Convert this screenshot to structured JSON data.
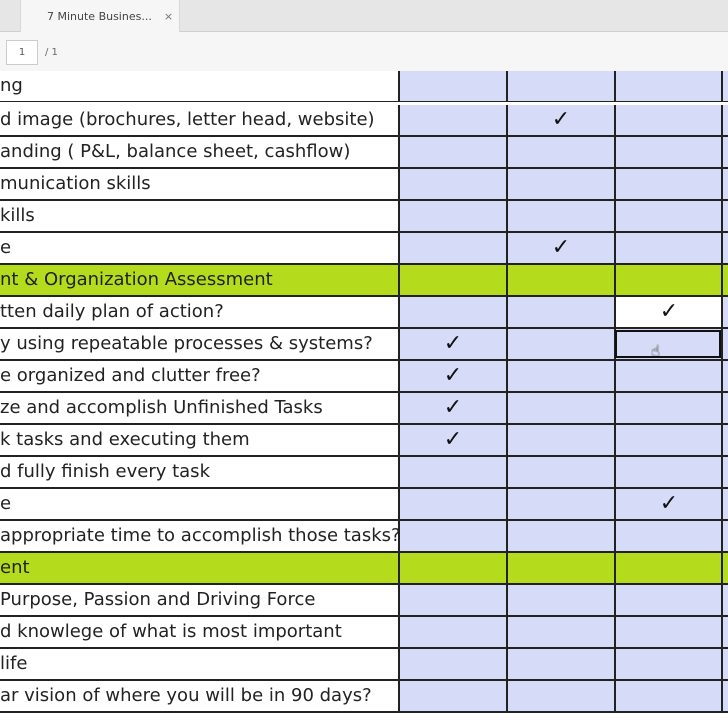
{
  "tab": {
    "title": "7 Minute Busines...",
    "close": "×"
  },
  "toolbar": {
    "page": "1",
    "total": "/ 1"
  },
  "check_mark": "✓",
  "rows": [
    {
      "text": "ng",
      "check": null,
      "section": false
    },
    {
      "text": "d image (brochures, letter head, website)",
      "check": 1,
      "section": false
    },
    {
      "text": "anding ( P&L, balance sheet, cashflow)",
      "check": null,
      "section": false
    },
    {
      "text": "munication skills",
      "check": null,
      "section": false
    },
    {
      "text": "kills",
      "check": null,
      "section": false
    },
    {
      "text": "e",
      "check": 1,
      "section": false
    },
    {
      "text": "nt & Organization Assessment",
      "check": null,
      "section": true
    },
    {
      "text": "tten daily plan of action?",
      "check": 2,
      "section": false,
      "white": 2
    },
    {
      "text": "y using repeatable processes & systems?",
      "check": 0,
      "section": false,
      "selected": 2
    },
    {
      "text": "e organized and clutter free?",
      "check": 0,
      "section": false
    },
    {
      "text": "ze and accomplish Unfinished Tasks",
      "check": 0,
      "section": false
    },
    {
      "text": "k tasks and executing them",
      "check": 0,
      "section": false
    },
    {
      "text": "d fully finish every task",
      "check": null,
      "section": false
    },
    {
      "text": "e",
      "check": 2,
      "section": false
    },
    {
      "text": "appropriate time to accomplish those tasks?",
      "check": null,
      "section": false
    },
    {
      "text": "ent",
      "check": null,
      "section": true
    },
    {
      "text": " Purpose, Passion and Driving Force",
      "check": null,
      "section": false
    },
    {
      "text": "d knowlege of what is most important",
      "check": null,
      "section": false
    },
    {
      "text": " life",
      "check": null,
      "section": false
    },
    {
      "text": "ar vision of where you will be in 90 days?",
      "check": null,
      "section": false
    }
  ]
}
